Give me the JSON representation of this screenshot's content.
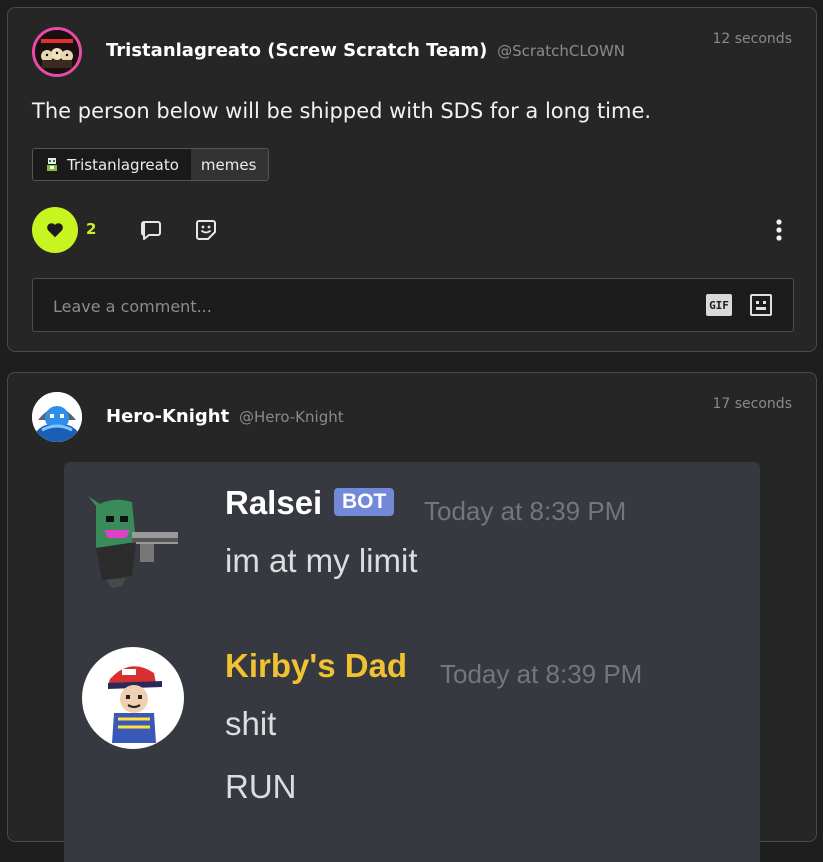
{
  "posts": [
    {
      "author": "Tristanlagreato (Screw Scratch Team)",
      "handle": "@ScratchCLOWN",
      "timestamp": "12 seconds",
      "text": "The person below will be shipped with SDS for a long time.",
      "tag_user": "Tristanlagreato",
      "tag_category": "memes",
      "like_count": "2",
      "comment_placeholder": "Leave a comment...",
      "gif_label": "GIF",
      "icons": [
        "heart-icon",
        "comment-icon",
        "sticker-icon",
        "more-vertical-icon",
        "emoji-icon"
      ]
    },
    {
      "author": "Hero-Knight",
      "handle": "@Hero-Knight",
      "timestamp": "17 seconds",
      "embedded_chat": {
        "messages": [
          {
            "name": "Ralsei",
            "badge": "BOT",
            "time": "Today at 8:39 PM",
            "name_color": "#ffffff",
            "lines": [
              "im at my limit"
            ]
          },
          {
            "name": "Kirby's Dad",
            "time": "Today at 8:39 PM",
            "name_color": "#f1c232",
            "lines": [
              "shit",
              "RUN"
            ]
          }
        ]
      }
    }
  ],
  "colors": {
    "background": "#1e1e1e",
    "card": "#262626",
    "accent": "#c8f41f",
    "avatar_ring": "#e84aa8",
    "discord_bg": "#36393f",
    "bot_badge": "#7289da"
  }
}
